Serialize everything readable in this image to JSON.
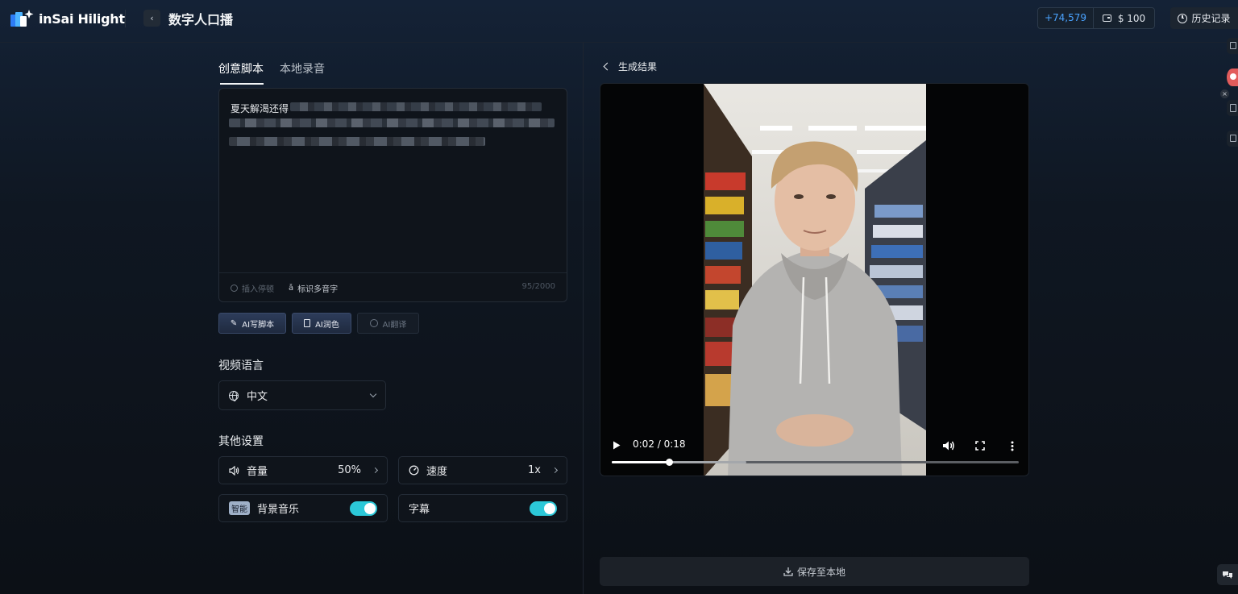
{
  "app": {
    "logo_text": "inSai Hilight",
    "page_title": "数字人口播"
  },
  "account": {
    "points": "+74,579",
    "balance": "$ 100",
    "history_label": "历史记录"
  },
  "script_panel": {
    "tabs": [
      {
        "label": "创意脚本",
        "active": true
      },
      {
        "label": "本地录音",
        "active": false
      }
    ],
    "editor_visible_text": "夏天解渴还得",
    "tools": {
      "insert_pause": "插入停顿",
      "polyphonic": "标识多音字"
    },
    "char_count": "95/2000",
    "ai_buttons": {
      "write": "AI写脚本",
      "polish": "AI润色",
      "translate": "AI翻译"
    }
  },
  "language": {
    "section_title": "视频语言",
    "selected": "中文"
  },
  "settings": {
    "section_title": "其他设置",
    "volume_label": "音量",
    "volume_value": "50%",
    "speed_label": "速度",
    "speed_value": "1x",
    "smart_badge": "智能",
    "bgm_label": "背景音乐",
    "bgm_on": true,
    "subtitle_label": "字幕",
    "subtitle_on": true
  },
  "result": {
    "title": "生成结果",
    "time_display": "0:02 / 0:18",
    "progress": 0.14,
    "buffered": 0.33,
    "save_label": "保存至本地"
  },
  "colors": {
    "accent_points": "#4aa3ff",
    "toggle_on": "#2cc8d8"
  }
}
